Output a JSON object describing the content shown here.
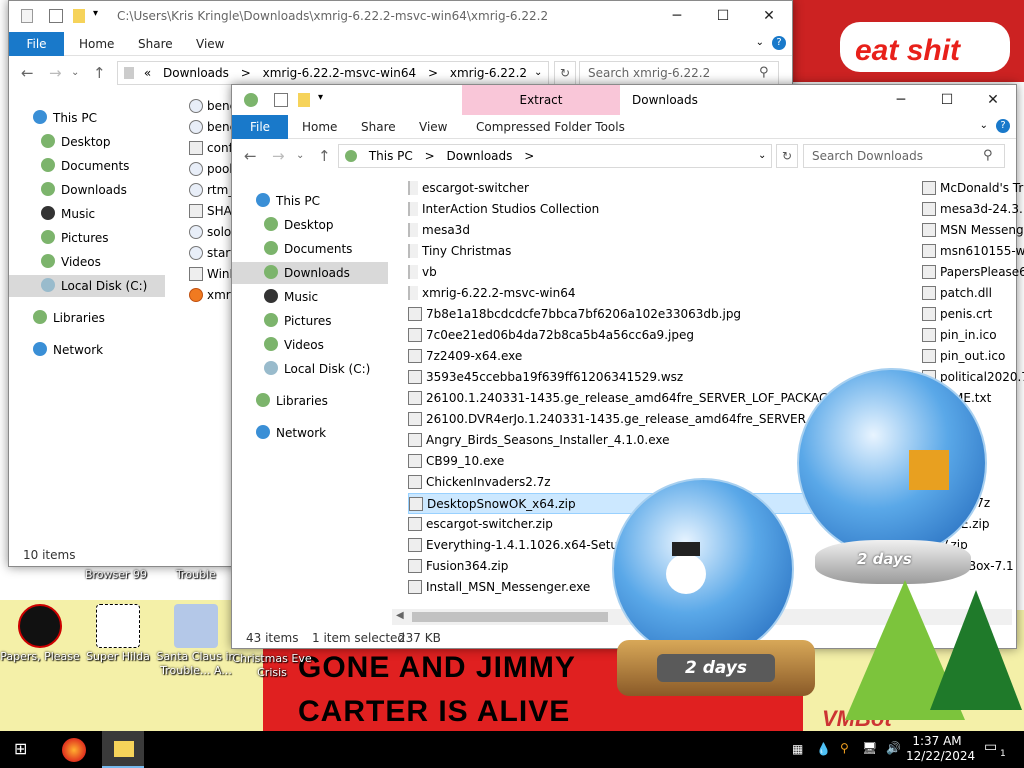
{
  "colors": {
    "accent": "#1979ca",
    "selected": "#cce8ff",
    "extract_tab": "#f9c6d8"
  },
  "wallpaper": {
    "banner": "eat shit",
    "line1": "GONE AND JIMMY",
    "line2": "CARTER IS ALIVE",
    "bot": "VMBot"
  },
  "desktop_icons": [
    {
      "label": "Browser 99"
    },
    {
      "label": "Trouble"
    },
    {
      "label": "Papers, Please"
    },
    {
      "label": "Super Hilda"
    },
    {
      "label": "Santa Claus in Trouble... A..."
    },
    {
      "label": "Christmas Eve Crisis"
    }
  ],
  "globes": {
    "a": "2 days",
    "b": "2 days"
  },
  "back_window": {
    "title": "C:\\Users\\Kris Kringle\\Downloads\\xmrig-6.22.2-msvc-win64\\xmrig-6.22.2",
    "tabs": [
      "File",
      "Home",
      "Share",
      "View"
    ],
    "breadcrumb": [
      "«",
      "Downloads",
      ">",
      "xmrig-6.22.2-msvc-win64",
      ">",
      "xmrig-6.22.2"
    ],
    "search_placeholder": "Search xmrig-6.22.2",
    "nav": [
      "This PC",
      "Desktop",
      "Documents",
      "Downloads",
      "Music",
      "Pictures",
      "Videos",
      "Local Disk (C:)",
      "Libraries",
      "Network"
    ],
    "files": [
      "benc",
      "benc",
      "confi",
      "pool_",
      "rtm_g",
      "SHA2",
      "solo_",
      "start.",
      "WinR",
      "xmrig"
    ],
    "status": "10 items"
  },
  "front_window": {
    "contextual": "Extract",
    "title": "Downloads",
    "tabs": [
      "File",
      "Home",
      "Share",
      "View",
      "Compressed Folder Tools"
    ],
    "breadcrumb": [
      "This PC",
      ">",
      "Downloads",
      ">"
    ],
    "search_placeholder": "Search Downloads",
    "nav": [
      "This PC",
      "Desktop",
      "Documents",
      "Downloads",
      "Music",
      "Pictures",
      "Videos",
      "Local Disk (C:)",
      "Libraries",
      "Network"
    ],
    "files_col1": [
      "escargot-switcher",
      "InterAction Studios Collection",
      "mesa3d",
      "Tiny Christmas",
      "vb",
      "xmrig-6.22.2-msvc-win64",
      "7b8e1a18bcdcdcfe7bbca7bf6206a102e33063db.jpg",
      "7c0ee21ed06b4da72b8ca5b4a56cc6a9.jpeg",
      "7z2409-x64.exe",
      "3593e45ccebba19f639ff61206341529.wsz",
      "26100.1.240331-1435.ge_release_amd64fre_SERVER_LOF_PACKAGES_OEM.iso",
      "26100.DVR4erJo.1.240331-1435.ge_release_amd64fre_SERVER_LOF_PACKA",
      "Angry_Birds_Seasons_Installer_4.1.0.exe",
      "CB99_10.exe",
      "ChickenInvaders2.7z",
      "DesktopSnowOK_x64.zip",
      "escargot-switcher.zip",
      "Everything-1.4.1.1026.x64-Setup.exe",
      "Fusion364.zip",
      "Install_MSN_Messenger.exe"
    ],
    "files_col2": [
      "McDonald's Tr",
      "mesa3d-24.3.1",
      "MSN Messeng",
      "msn610155-w",
      "PapersPlease6",
      "patch.dll",
      "penis.crt",
      "pin_in.ico",
      "pin_out.ico",
      "political2020.7",
      "D ME.txt",
      "txt",
      "up.exe",
      "ny_ch",
      "ndertal",
      "xmas.7z",
      "d_PE.zip",
      "V.zip",
      "rtualBox-7.1"
    ],
    "status_items": "43 items",
    "status_selected": "1 item selected",
    "status_size": "237 KB"
  },
  "taskbar": {
    "time": "1:37 AM",
    "date": "12/22/2024",
    "notif": "1"
  }
}
